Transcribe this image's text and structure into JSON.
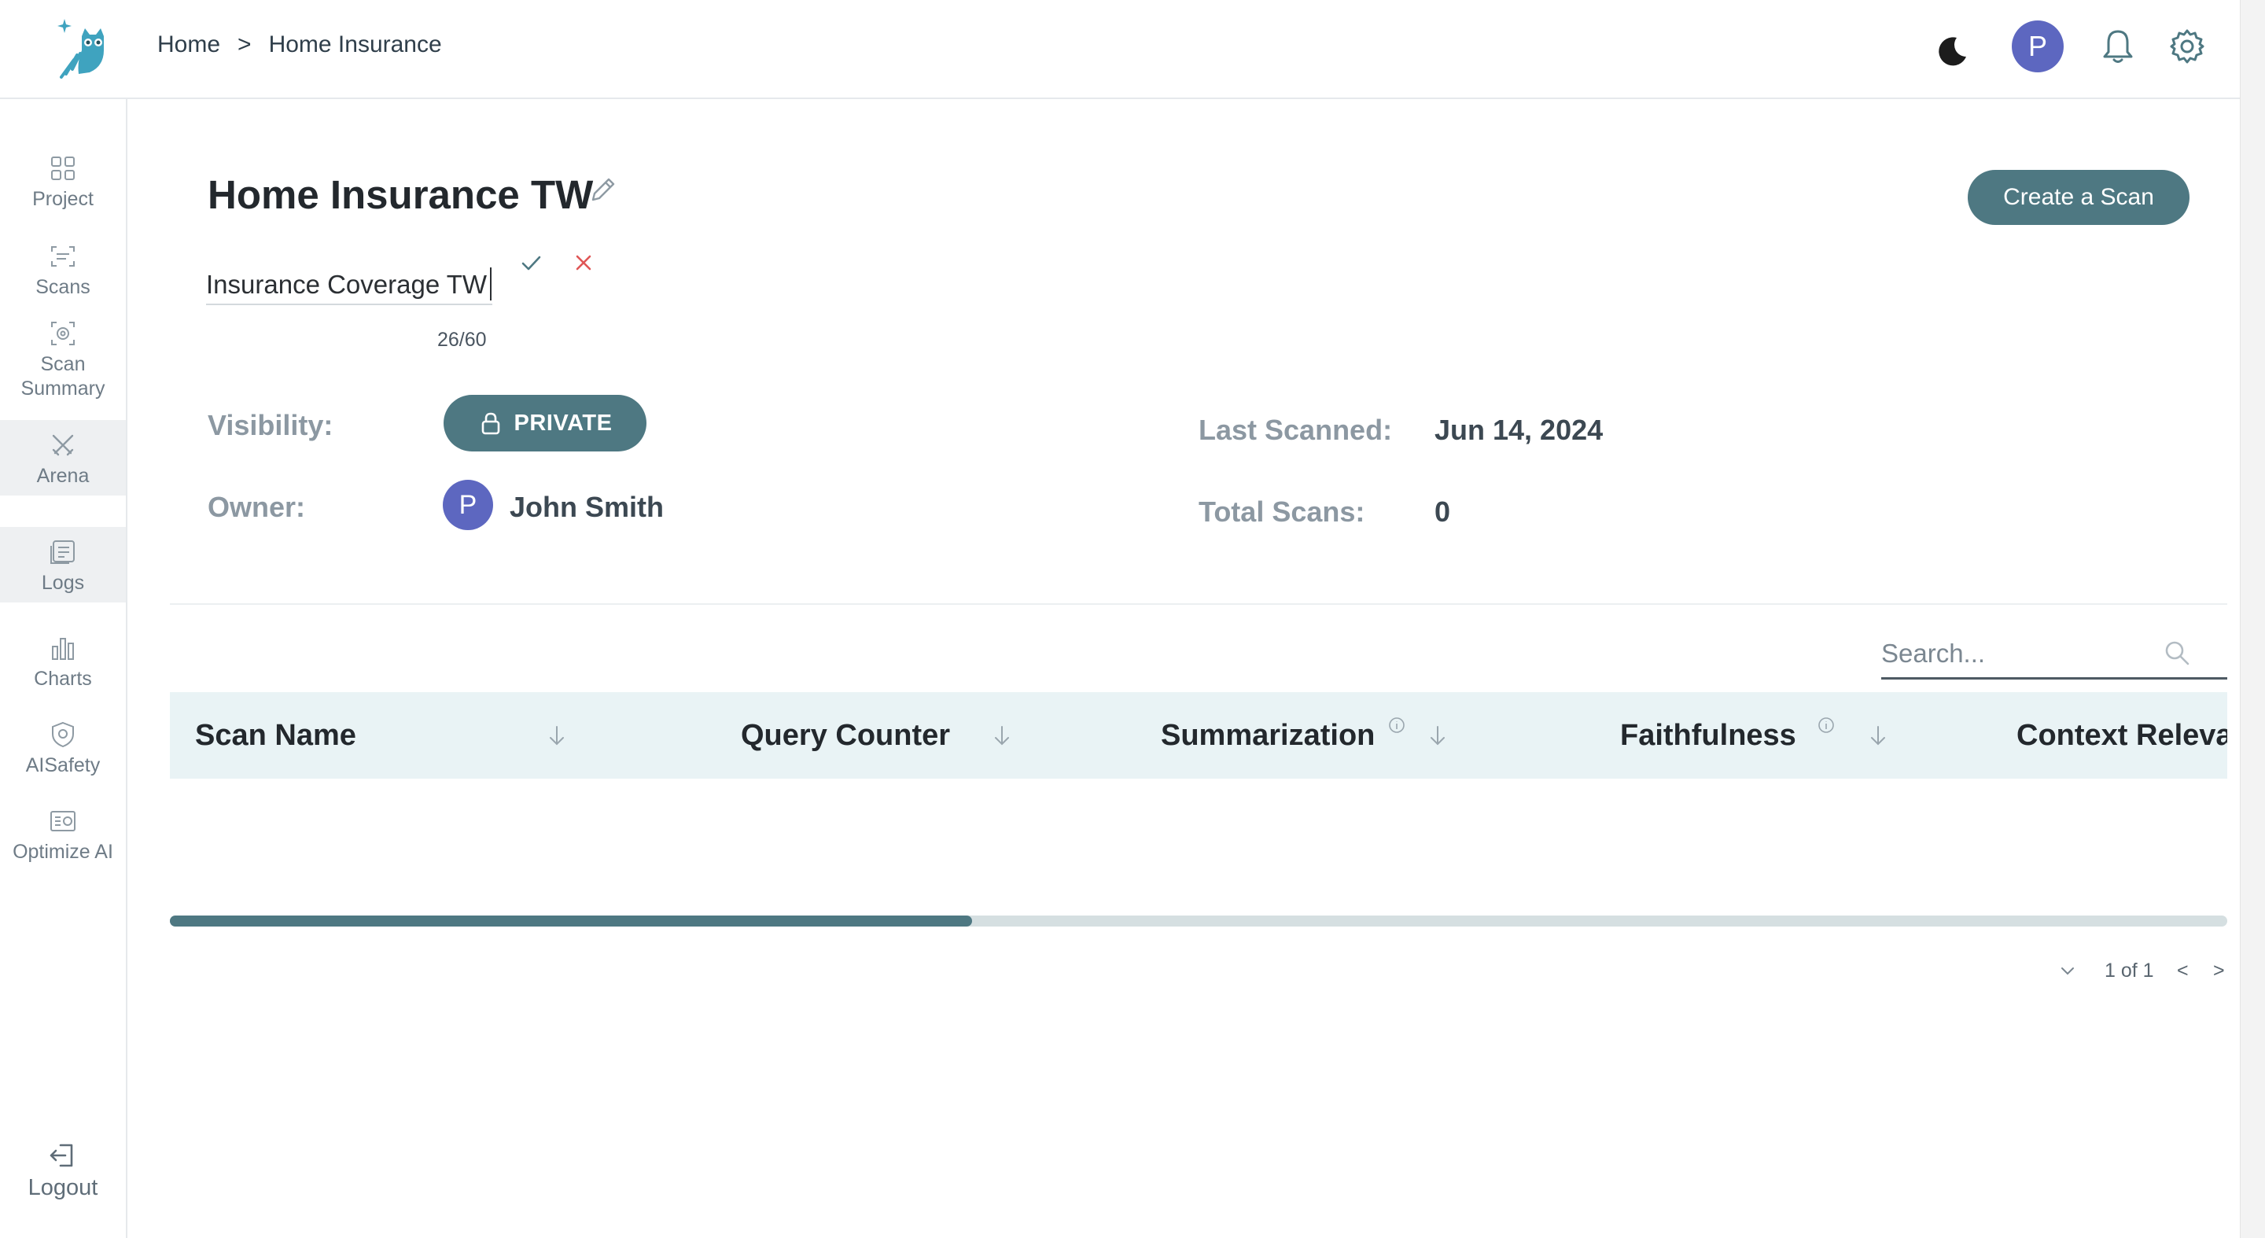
{
  "breadcrumb": {
    "home": "Home",
    "separator": ">",
    "current": "Home Insurance"
  },
  "header": {
    "icons": [
      "moon-icon",
      "bell-icon",
      "gear-icon"
    ],
    "avatar_initial": "P"
  },
  "sidebar": {
    "items": [
      {
        "label": "Project",
        "icon": "grid-icon"
      },
      {
        "label": "Scans",
        "icon": "scan-icon"
      },
      {
        "label": "Scan Summary",
        "icon": "scan-summary-icon"
      },
      {
        "label": "Arena",
        "icon": "arena-icon",
        "active": true
      },
      {
        "label": "Logs",
        "icon": "logs-icon",
        "active": true
      },
      {
        "label": "Charts",
        "icon": "bar-chart-icon"
      },
      {
        "label": "AISafety",
        "icon": "shield-icon"
      },
      {
        "label": "Optimize AI",
        "icon": "optimize-icon"
      }
    ],
    "logout": "Logout"
  },
  "project": {
    "title": "Home Insurance TW",
    "create_button": "Create a Scan",
    "name_input_value": "Insurance Coverage TW",
    "char_count": "26/60",
    "visibility_label": "Visibility:",
    "visibility_value": "PRIVATE",
    "owner_label": "Owner:",
    "owner_initial": "P",
    "owner_name": "John Smith",
    "last_scanned_label": "Last Scanned:",
    "last_scanned_value": "Jun 14, 2024",
    "total_scans_label": "Total Scans:",
    "total_scans_value": "0"
  },
  "table": {
    "search_placeholder": "Search...",
    "columns": [
      "Scan Name",
      "Query Counter",
      "Summarization",
      "Faithfulness",
      "Context Releva"
    ],
    "rows": [],
    "scroll_fraction": 0.39
  },
  "pagination": {
    "label": "1 of 1",
    "prev": "<",
    "next": ">"
  },
  "colors": {
    "accent": "#4e7882",
    "avatar": "#5d67c0",
    "header_bg": "#e9f3f5",
    "cancel": "#e05656",
    "confirm": "#4e7882"
  }
}
